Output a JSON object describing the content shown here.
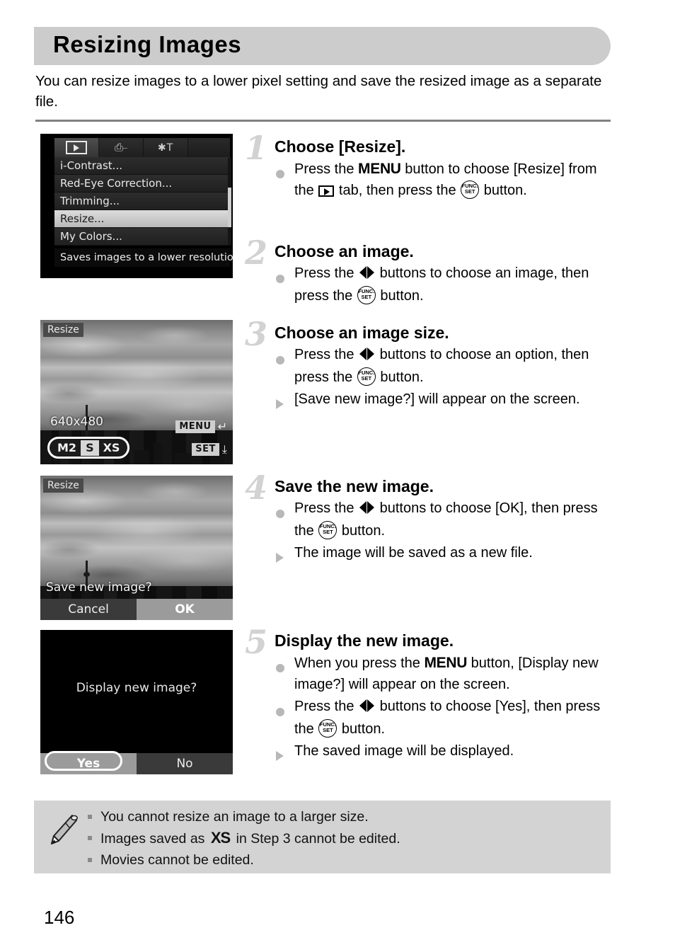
{
  "page": {
    "title": "Resizing Images",
    "intro": "You can resize images to a lower pixel setting and save the resized image as a separate file.",
    "number": "146"
  },
  "screens": {
    "menu": {
      "label": "playback-menu",
      "tabs": [
        "playback-tab-icon",
        "print-tab-icon",
        "settings-tab-icon"
      ],
      "items": [
        "i-Contrast...",
        "Red-Eye Correction...",
        "Trimming...",
        "Resize...",
        "My Colors..."
      ],
      "selected_item": "Resize...",
      "hint": "Saves images to a lower resolution"
    },
    "resize_size": {
      "label": "Resize",
      "dimension": "640x480",
      "options": [
        "M2",
        "S",
        "XS"
      ],
      "selected_option": "S",
      "menu_badge": "MENU",
      "menu_arrow": "return-arrow-icon",
      "set_badge": "SET",
      "set_arrow": "save-icon"
    },
    "save_prompt": {
      "label": "Resize",
      "question": "Save new image?",
      "buttons": [
        "Cancel",
        "OK"
      ],
      "selected_button": "OK"
    },
    "display_prompt": {
      "question": "Display new image?",
      "buttons": [
        "Yes",
        "No"
      ],
      "selected_button": "Yes"
    }
  },
  "steps": [
    {
      "num": "1",
      "title": "Choose [Resize].",
      "lines": [
        {
          "marker": "dot",
          "parts": [
            {
              "t": "text",
              "v": "Press the "
            },
            {
              "t": "menu"
            },
            {
              "t": "text",
              "v": " button to choose [Resize] from the "
            },
            {
              "t": "play"
            },
            {
              "t": "text",
              "v": " tab, then press the "
            },
            {
              "t": "func"
            },
            {
              "t": "text",
              "v": " button."
            }
          ]
        }
      ]
    },
    {
      "num": "2",
      "title": "Choose an image.",
      "lines": [
        {
          "marker": "dot",
          "parts": [
            {
              "t": "text",
              "v": "Press the "
            },
            {
              "t": "lr"
            },
            {
              "t": "text",
              "v": " buttons to choose an image, then press the "
            },
            {
              "t": "func"
            },
            {
              "t": "text",
              "v": " button."
            }
          ]
        }
      ]
    },
    {
      "num": "3",
      "title": "Choose an image size.",
      "lines": [
        {
          "marker": "dot",
          "parts": [
            {
              "t": "text",
              "v": "Press the "
            },
            {
              "t": "lr"
            },
            {
              "t": "text",
              "v": " buttons to choose an option, then press the "
            },
            {
              "t": "func"
            },
            {
              "t": "text",
              "v": " button."
            }
          ]
        },
        {
          "marker": "tri",
          "parts": [
            {
              "t": "text",
              "v": "[Save new image?] will appear on the screen."
            }
          ]
        }
      ]
    },
    {
      "num": "4",
      "title": "Save the new image.",
      "lines": [
        {
          "marker": "dot",
          "parts": [
            {
              "t": "text",
              "v": "Press the "
            },
            {
              "t": "lr"
            },
            {
              "t": "text",
              "v": " buttons to choose [OK], then press the "
            },
            {
              "t": "func"
            },
            {
              "t": "text",
              "v": " button."
            }
          ]
        },
        {
          "marker": "tri",
          "parts": [
            {
              "t": "text",
              "v": "The image will be saved as a new file."
            }
          ]
        }
      ]
    },
    {
      "num": "5",
      "title": "Display the new image.",
      "lines": [
        {
          "marker": "dot",
          "parts": [
            {
              "t": "text",
              "v": "When you press the "
            },
            {
              "t": "menu"
            },
            {
              "t": "text",
              "v": " button, [Display new image?] will appear on the screen."
            }
          ]
        },
        {
          "marker": "dot",
          "parts": [
            {
              "t": "text",
              "v": "Press the "
            },
            {
              "t": "lr"
            },
            {
              "t": "text",
              "v": " buttons to choose [Yes], then press the "
            },
            {
              "t": "func"
            },
            {
              "t": "text",
              "v": " button."
            }
          ]
        },
        {
          "marker": "tri",
          "parts": [
            {
              "t": "text",
              "v": "The saved image will be displayed."
            }
          ]
        }
      ]
    }
  ],
  "notes": {
    "icon": "pencil-icon",
    "items": [
      {
        "parts": [
          {
            "t": "text",
            "v": "You cannot resize an image to a larger size."
          }
        ]
      },
      {
        "parts": [
          {
            "t": "text",
            "v": "Images saved as "
          },
          {
            "t": "xs"
          },
          {
            "t": "text",
            "v": " in Step 3 cannot be edited."
          }
        ]
      },
      {
        "parts": [
          {
            "t": "text",
            "v": "Movies cannot be edited."
          }
        ]
      }
    ]
  },
  "glyph_text": {
    "menu": "MENU",
    "func_top": "FUNC.",
    "func_bottom": "SET",
    "xs": "XS"
  },
  "colors": {
    "title_bar": "#cccccc",
    "rule": "#808080",
    "step_number": "#d2d2d2",
    "marker": "#b8b8b8",
    "notes_bg": "#d3d3d3"
  }
}
